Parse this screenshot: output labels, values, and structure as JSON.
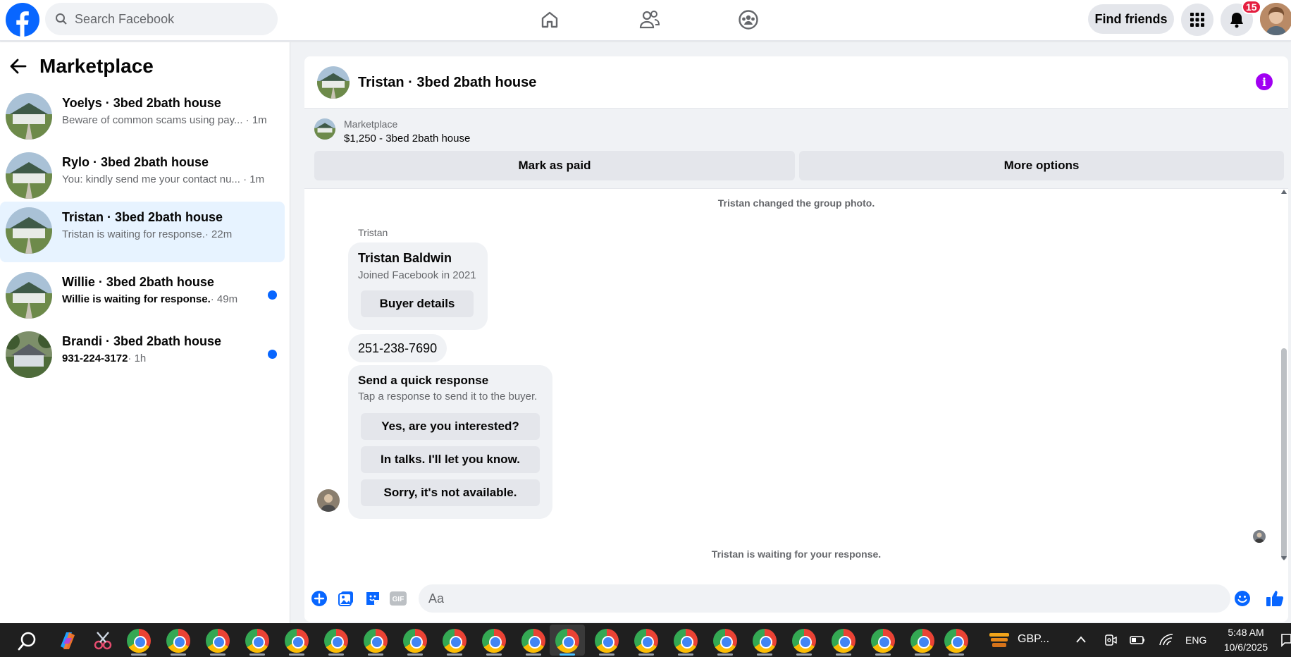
{
  "topbar": {
    "search_placeholder": "Search Facebook",
    "find_friends_label": "Find friends",
    "notification_count": "15"
  },
  "sidebar": {
    "title": "Marketplace",
    "conversations": [
      {
        "name": "Yoelys · 3bed 2bath house",
        "preview": "Beware of common scams using pay...",
        "time": "· 1m",
        "unread": false
      },
      {
        "name": "Rylo · 3bed 2bath house",
        "preview": "You: kindly send me your contact nu...",
        "time": "· 1m",
        "unread": false
      },
      {
        "name": "Tristan · 3bed 2bath house",
        "preview": "Tristan is waiting for response.",
        "time": "· 22m",
        "unread": false
      },
      {
        "name": "Willie · 3bed 2bath house",
        "preview": "Willie is waiting for response.",
        "time": "· 49m",
        "unread": true
      },
      {
        "name": "Brandi · 3bed 2bath house",
        "preview": "931-224-3172",
        "time": "· 1h",
        "unread": true
      }
    ]
  },
  "chat": {
    "title": "Tristan · 3bed 2bath house",
    "listing": {
      "kind": "Marketplace",
      "price_title": "$1,250 - 3bed 2bath house",
      "mark_paid_label": "Mark as paid",
      "more_options_label": "More options"
    },
    "system_top": "Tristan changed the group photo.",
    "sender_name": "Tristan",
    "profile_card": {
      "name": "Tristan Baldwin",
      "joined": "Joined Facebook in 2021",
      "button_label": "Buyer details"
    },
    "phone_message": "251-238-7690",
    "quick_response": {
      "title": "Send a quick response",
      "subtitle": "Tap a response to send it to the buyer.",
      "options": [
        "Yes, are you interested?",
        "In talks. I'll let you know.",
        "Sorry, it's not available."
      ]
    },
    "system_bottom": "Tristan is waiting for your response.",
    "composer_placeholder": "Aa"
  },
  "taskbar": {
    "tray_app_label": "GBP...",
    "language": "ENG",
    "time": "5:48 AM",
    "date": "10/6/2025"
  },
  "colors": {
    "brand_blue": "#0866ff",
    "active_row": "#e7f3ff",
    "info_purple": "#a100f2",
    "badge_red": "#e41e3f"
  }
}
